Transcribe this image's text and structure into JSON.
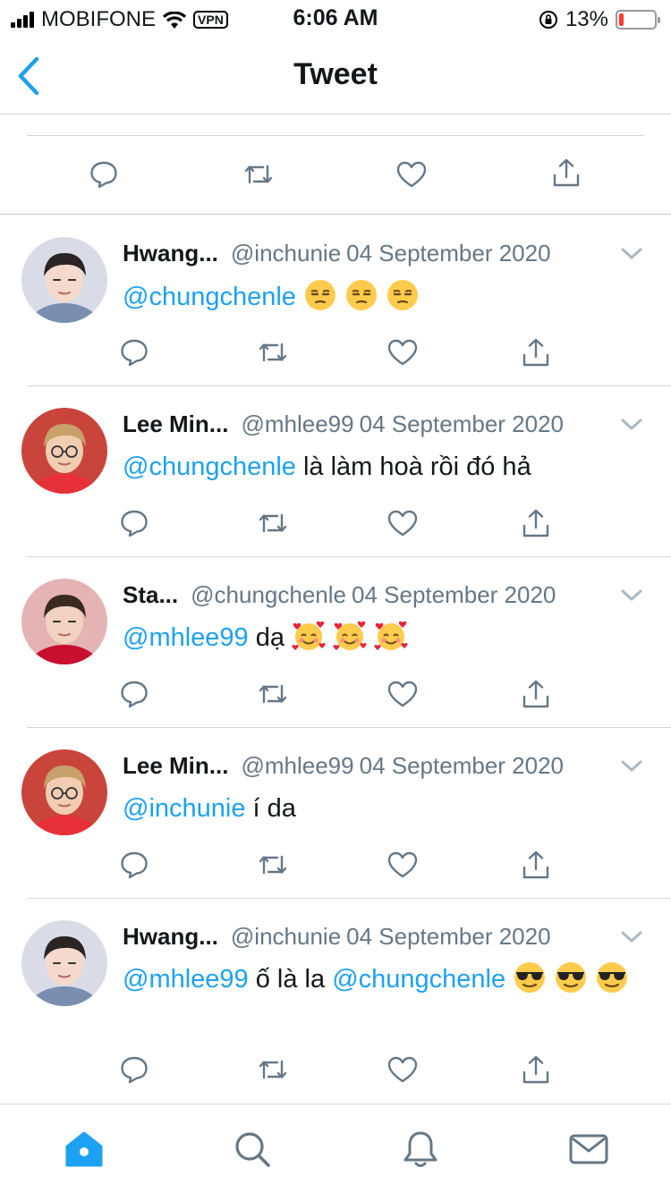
{
  "status_bar": {
    "carrier": "MOBIFONE",
    "vpn": "VPN",
    "time": "6:06 AM",
    "battery": "13%",
    "battery_level": 0.13,
    "battery_color": "#ff3b30"
  },
  "nav": {
    "title": "Tweet",
    "back_icon": "chevron-left-icon"
  },
  "colors": {
    "accent": "#1da1f2",
    "secondary_text": "#657786",
    "icon": "#657786"
  },
  "actions": [
    "reply-icon",
    "retweet-icon",
    "like-icon",
    "share-icon"
  ],
  "replies": [
    {
      "name": "Hwang...",
      "handle": "@inchunie",
      "date": "04 September 2020",
      "body": [
        {
          "type": "mention",
          "text": "@chungchenle"
        },
        {
          "type": "text",
          "text": " "
        },
        {
          "type": "emoji",
          "name": "unamused-face"
        },
        {
          "type": "emoji",
          "name": "unamused-face"
        },
        {
          "type": "emoji",
          "name": "unamused-face"
        }
      ]
    },
    {
      "name": "Lee Min...",
      "handle": "@mhlee99",
      "date": "04 September 2020",
      "body": [
        {
          "type": "mention",
          "text": "@chungchenle"
        },
        {
          "type": "text",
          "text": " là làm hoà rồi đó hả"
        }
      ]
    },
    {
      "name": "Sta...",
      "handle": "@chungchenle",
      "date": "04 September 2020",
      "body": [
        {
          "type": "mention",
          "text": "@mhlee99"
        },
        {
          "type": "text",
          "text": " dạ "
        },
        {
          "type": "emoji",
          "name": "smiling-face-with-hearts"
        },
        {
          "type": "emoji",
          "name": "smiling-face-with-hearts"
        },
        {
          "type": "emoji",
          "name": "smiling-face-with-hearts"
        }
      ]
    },
    {
      "name": "Lee Min...",
      "handle": "@mhlee99",
      "date": "04 September 2020",
      "body": [
        {
          "type": "mention",
          "text": "@inchunie"
        },
        {
          "type": "text",
          "text": " í da"
        }
      ]
    },
    {
      "name": "Hwang...",
      "handle": "@inchunie",
      "date": "04 September 2020",
      "body": [
        {
          "type": "mention",
          "text": "@mhlee99"
        },
        {
          "type": "text",
          "text": " ố là la "
        },
        {
          "type": "mention",
          "text": "@chungchenle"
        },
        {
          "type": "text",
          "text": " "
        },
        {
          "type": "emoji",
          "name": "smiling-face-with-sunglasses"
        },
        {
          "type": "emoji",
          "name": "smiling-face-with-sunglasses"
        },
        {
          "type": "emoji",
          "name": "smiling-face-with-sunglasses"
        }
      ]
    }
  ],
  "tab_bar": [
    {
      "name": "home-icon",
      "active": true
    },
    {
      "name": "search-icon",
      "active": false
    },
    {
      "name": "notifications-icon",
      "active": false
    },
    {
      "name": "messages-icon",
      "active": false
    }
  ]
}
